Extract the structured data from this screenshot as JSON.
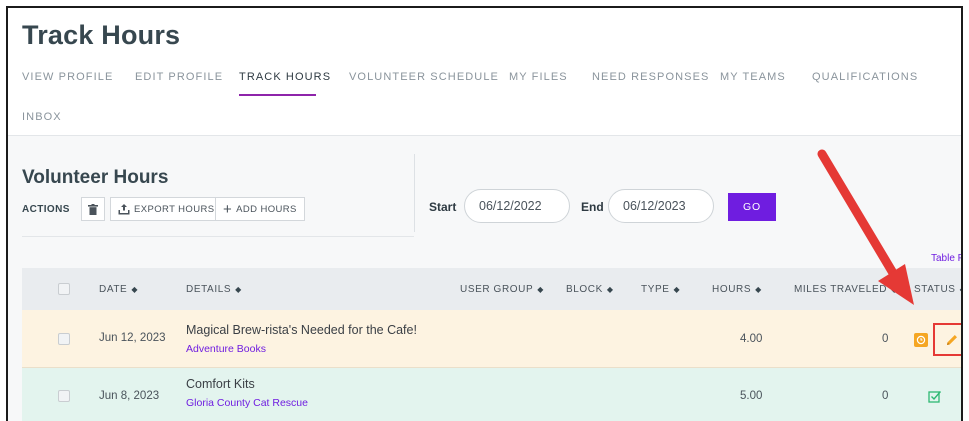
{
  "page_title": "Track Hours",
  "nav": [
    {
      "label": "VIEW PROFILE"
    },
    {
      "label": "EDIT PROFILE"
    },
    {
      "label": "TRACK HOURS",
      "active": true
    },
    {
      "label": "VOLUNTEER SCHEDULE"
    },
    {
      "label": "MY FILES"
    },
    {
      "label": "NEED RESPONSES"
    },
    {
      "label": "MY TEAMS"
    },
    {
      "label": "QUALIFICATIONS"
    },
    {
      "label": "INBOX"
    }
  ],
  "section": {
    "title": "Volunteer Hours",
    "actions_label": "ACTIONS",
    "export_label": "EXPORT HOURS",
    "add_label": "ADD HOURS"
  },
  "filters": {
    "start_label": "Start",
    "start_value": "06/12/2022",
    "end_label": "End",
    "end_value": "06/12/2023",
    "go_label": "GO",
    "table_filter_label": "Table Filter"
  },
  "table": {
    "headers": {
      "date": "DATE",
      "details": "DETAILS",
      "user_group": "USER GROUP",
      "block": "BLOCK",
      "type": "TYPE",
      "hours": "HOURS",
      "miles": "MILES TRAVELED",
      "status": "STATUS"
    },
    "rows": [
      {
        "date": "Jun 12, 2023",
        "title": "Magical Brew-rista's Needed for the Cafe!",
        "org": "Adventure Books",
        "hours": "4.00",
        "miles": "0",
        "status": "pending"
      },
      {
        "date": "Jun 8, 2023",
        "title": "Comfort Kits",
        "org": "Gloria County Cat Rescue",
        "hours": "5.00",
        "miles": "0",
        "status": "approved"
      }
    ]
  },
  "colors": {
    "accent": "#6f1de0",
    "pending_row": "#fdf3e1",
    "approved_row": "#e3f4ee",
    "highlight": "#e53935",
    "arrow": "#e53935"
  }
}
